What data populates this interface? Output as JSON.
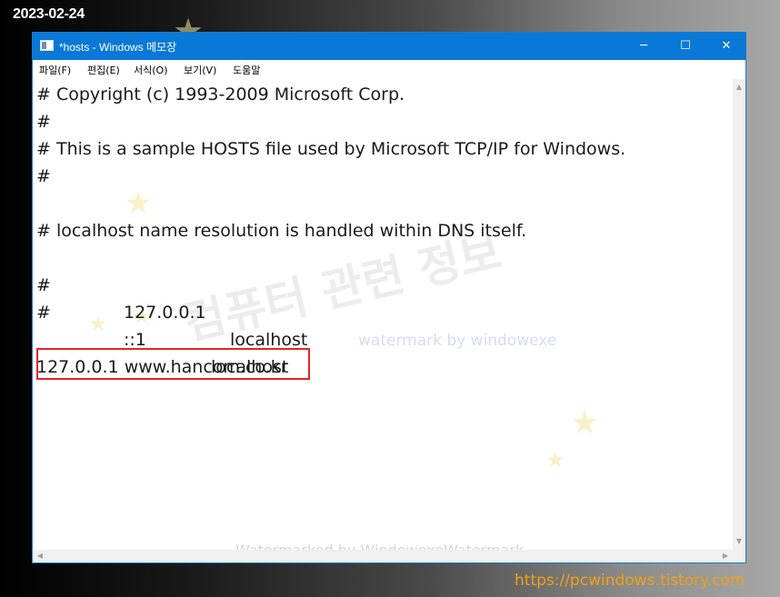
{
  "overlay": {
    "date": "2023-02-24",
    "blog_url": "https://pcwindows.tistory.com"
  },
  "window": {
    "title": "*hosts - Windows 메모장",
    "controls": {
      "minimize": "─",
      "maximize": "☐",
      "close": "✕"
    }
  },
  "menu": [
    {
      "label": "파일(F)"
    },
    {
      "label": "편집(E)"
    },
    {
      "label": "서식(O)"
    },
    {
      "label": "보기(V)"
    },
    {
      "label": "도움말"
    }
  ],
  "editor": {
    "lines": [
      {
        "text": "# Copyright (c) 1993-2009 Microsoft Corp."
      },
      {
        "text": "#"
      },
      {
        "text": "# This is a sample HOSTS file used by Microsoft TCP/IP for Windows."
      },
      {
        "text": "#"
      },
      {
        "text": "# localhost name resolution is handled within DNS itself."
      }
    ],
    "host_entries": [
      {
        "hash": "#",
        "address": "127.0.0.1",
        "name": "localhost"
      },
      {
        "hash": "#",
        "address": "::1",
        "name": "localhost"
      }
    ],
    "added_entry": "127.0.0.1 www.hancom.co.kr"
  },
  "watermarks": {
    "korean": "컴퓨터 관련 정보",
    "blue": "watermark by windowexe",
    "bottom": "Watermarked by WindowexeWatermark"
  },
  "colors": {
    "titlebar": "#0a78d7",
    "highlight_border": "#e0262b",
    "url_text": "#f2a012"
  },
  "icons": {
    "app": "notepad-icon",
    "minimize": "minimize-icon",
    "maximize": "maximize-icon",
    "close": "close-icon",
    "decoration": "star-icon"
  }
}
